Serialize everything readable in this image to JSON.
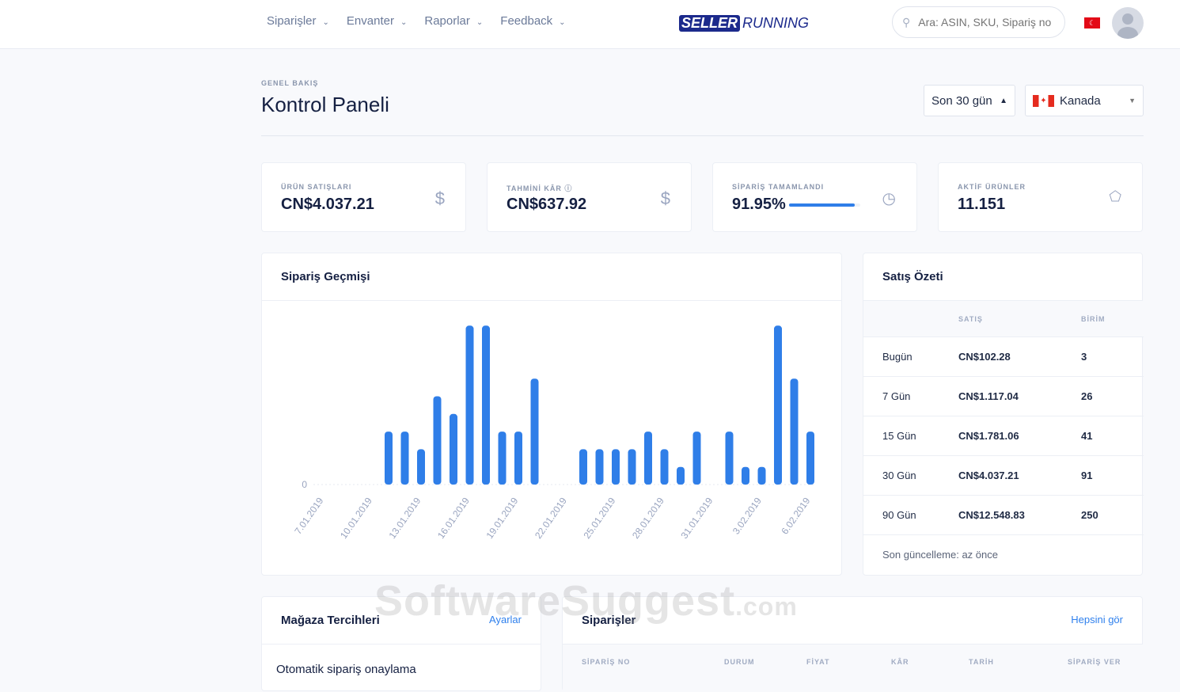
{
  "nav": {
    "items": [
      "Siparişler",
      "Envanter",
      "Raporlar",
      "Feedback"
    ],
    "logo": [
      "SELLER",
      "RUNNING"
    ],
    "search_placeholder": "Ara: ASIN, SKU, Sipariş no"
  },
  "header": {
    "eyebrow": "GENEL BAKIŞ",
    "title": "Kontrol Paneli",
    "period": "Son 30 gün",
    "country": "Kanada"
  },
  "stats": [
    {
      "label": "ÜRÜN SATIŞLARI",
      "value": "CN$4.037.21",
      "icon": "dollar-icon"
    },
    {
      "label": "TAHMİNİ KÂR ⓘ",
      "value": "CN$637.92",
      "icon": "dollar-icon"
    },
    {
      "label": "SİPARİŞ TAMAMLANDI",
      "value": "91.95%",
      "progress": 0.9195,
      "icon": "clock-icon"
    },
    {
      "label": "AKTİF ÜRÜNLER",
      "value": "11.151",
      "icon": "tag-icon"
    }
  ],
  "order_history": {
    "title": "Sipariş Geçmişi"
  },
  "chart_data": {
    "type": "bar",
    "title": "Sipariş Geçmişi",
    "y_ticks": [
      "0"
    ],
    "ylim": [
      0,
      9
    ],
    "x_ticks": [
      "7.01.2019",
      "10.01.2019",
      "13.01.2019",
      "16.01.2019",
      "19.01.2019",
      "22.01.2019",
      "25.01.2019",
      "28.01.2019",
      "31.01.2019",
      "3.02.2019",
      "6.02.2019"
    ],
    "start": "7.01.2019",
    "values": [
      0,
      0,
      0,
      0,
      3,
      3,
      2,
      5,
      4,
      9,
      9,
      3,
      3,
      6,
      0,
      0,
      2,
      2,
      2,
      2,
      3,
      2,
      1,
      3,
      0,
      3,
      1,
      1,
      9,
      6,
      3
    ],
    "color": "#2f7ee8"
  },
  "summary": {
    "title": "Satış Özeti",
    "headers": [
      "SATIŞ",
      "BİRİM"
    ],
    "rows": [
      {
        "label": "Bugün",
        "sales": "CN$102.28",
        "units": "3"
      },
      {
        "label": "7 Gün",
        "sales": "CN$1.117.04",
        "units": "26"
      },
      {
        "label": "15 Gün",
        "sales": "CN$1.781.06",
        "units": "41"
      },
      {
        "label": "30 Gün",
        "sales": "CN$4.037.21",
        "units": "91"
      },
      {
        "label": "90 Gün",
        "sales": "CN$12.548.83",
        "units": "250"
      }
    ],
    "footer": "Son güncelleme: az önce"
  },
  "prefs": {
    "title": "Mağaza Tercihleri",
    "link": "Ayarlar",
    "item": "Otomatik sipariş onaylama"
  },
  "orders": {
    "title": "Siparişler",
    "link": "Hepsini gör",
    "headers": [
      "SİPARİŞ NO",
      "DURUM",
      "FİYAT",
      "KÂR",
      "TARİH",
      "SİPARİŞ VER"
    ]
  },
  "watermark": "SoftwareSuggest.com"
}
